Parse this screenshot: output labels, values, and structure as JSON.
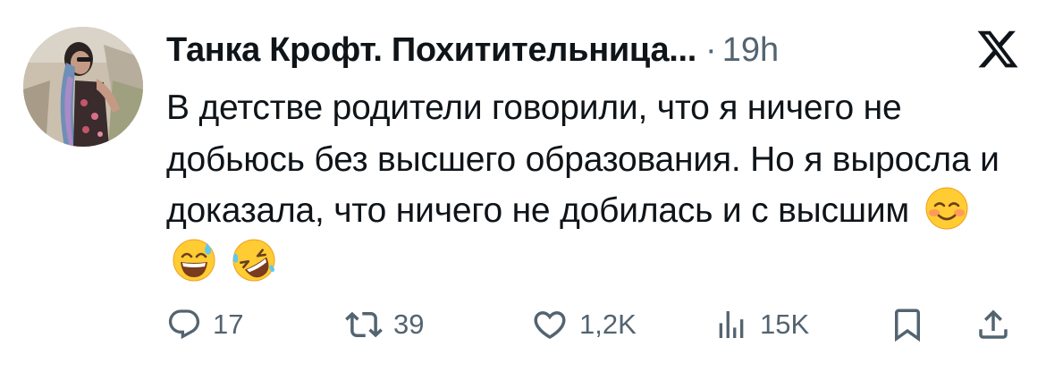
{
  "tweet": {
    "author_name": "Танка Крофт. Похитительница...",
    "separator": "·",
    "time": "19h",
    "text": "В детстве родители говорили, что я ничего не добьюсь без высшего образования. Но я выросла и доказала, что ничего не добилась и с высшим",
    "emojis": [
      "smiling-face-icon",
      "grinning-sweat-face-icon",
      "rolling-on-floor-laughing-icon"
    ]
  },
  "actions": {
    "replies": "17",
    "reposts": "39",
    "likes": "1,2K",
    "views": "15K"
  },
  "colors": {
    "text": "#0f1419",
    "secondary": "#536471",
    "background": "#ffffff"
  }
}
